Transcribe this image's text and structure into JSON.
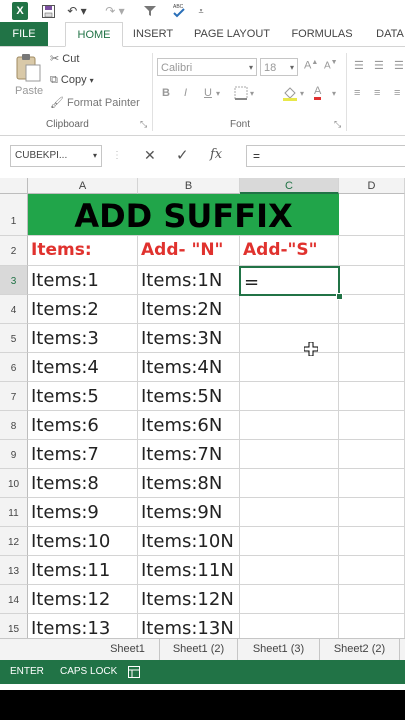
{
  "qat": {
    "logo": "X"
  },
  "tabs": [
    {
      "id": "file",
      "label": "FILE"
    },
    {
      "id": "home",
      "label": "HOME"
    },
    {
      "id": "insert",
      "label": "INSERT"
    },
    {
      "id": "page-layout",
      "label": "PAGE LAYOUT"
    },
    {
      "id": "formulas",
      "label": "FORMULAS"
    },
    {
      "id": "data",
      "label": "DATA"
    }
  ],
  "clipboard": {
    "paste_label": "Paste",
    "cut_label": "Cut",
    "copy_label": "Copy",
    "format_painter_label": "Format Painter",
    "group_label": "Clipboard"
  },
  "font": {
    "family": "Calibri",
    "size": "18",
    "bold": "B",
    "italic": "I",
    "underline": "U",
    "group_label": "Font"
  },
  "formula_bar": {
    "name_box": "CUBEKPI...",
    "fx": "fx",
    "content": "="
  },
  "columns": [
    "A",
    "B",
    "C",
    "D"
  ],
  "rows": [
    "1",
    "2",
    "3",
    "4",
    "5",
    "6",
    "7",
    "8",
    "9",
    "10",
    "11",
    "12",
    "13",
    "14",
    "15"
  ],
  "sheet": {
    "title": "ADD SUFFIX",
    "headers": [
      "Items:",
      "Add- \"N\"",
      "Add-\"S\""
    ],
    "items": [
      [
        "Items:1",
        "Items:1N"
      ],
      [
        "Items:2",
        "Items:2N"
      ],
      [
        "Items:3",
        "Items:3N"
      ],
      [
        "Items:4",
        "Items:4N"
      ],
      [
        "Items:5",
        "Items:5N"
      ],
      [
        "Items:6",
        "Items:6N"
      ],
      [
        "Items:7",
        "Items:7N"
      ],
      [
        "Items:8",
        "Items:8N"
      ],
      [
        "Items:9",
        "Items:9N"
      ],
      [
        "Items:10",
        "Items:10N"
      ],
      [
        "Items:11",
        "Items:11N"
      ],
      [
        "Items:12",
        "Items:12N"
      ],
      [
        "Items:13",
        "Items:13N"
      ]
    ],
    "active_cell_value": "="
  },
  "sheet_tabs": [
    "Sheet1",
    "Sheet1 (2)",
    "Sheet1 (3)",
    "Sheet2 (2)"
  ],
  "status": {
    "mode": "ENTER",
    "caps": "CAPS LOCK"
  },
  "colors": {
    "excel_green": "#217346",
    "title_fill": "#21a54a",
    "header_red": "#e0322e"
  }
}
